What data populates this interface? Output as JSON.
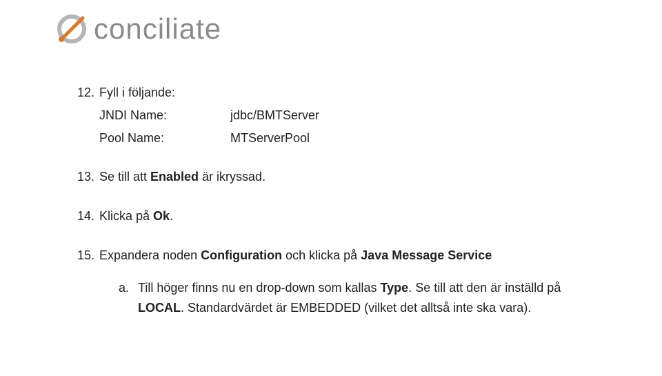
{
  "logo": {
    "text": "conciliate"
  },
  "items": [
    {
      "num": "12.",
      "lead": "Fyll i följande:",
      "fields": [
        {
          "label": "JNDI Name:",
          "value": "jdbc/BMTServer"
        },
        {
          "label": "Pool Name:",
          "value": "MTServerPool"
        }
      ]
    },
    {
      "num": "13.",
      "text_before": "Se till att ",
      "bold1": "Enabled",
      "text_after": " är ikryssad."
    },
    {
      "num": "14.",
      "text_before": "Klicka på ",
      "bold1": "Ok",
      "text_after": "."
    },
    {
      "num": "15.",
      "text_before": "Expandera noden ",
      "bold1": "Configuration",
      "text_mid": " och klicka på ",
      "bold2": "Java Message Service",
      "sub": {
        "letter": "a.",
        "p1": "Till höger finns nu en drop-down som kallas ",
        "b1": "Type",
        "p2": ". Se till att den är inställd på ",
        "b2": "LOCAL",
        "p3": ". Standardvärdet är EMBEDDED (vilket det alltså inte ska vara)."
      }
    }
  ]
}
